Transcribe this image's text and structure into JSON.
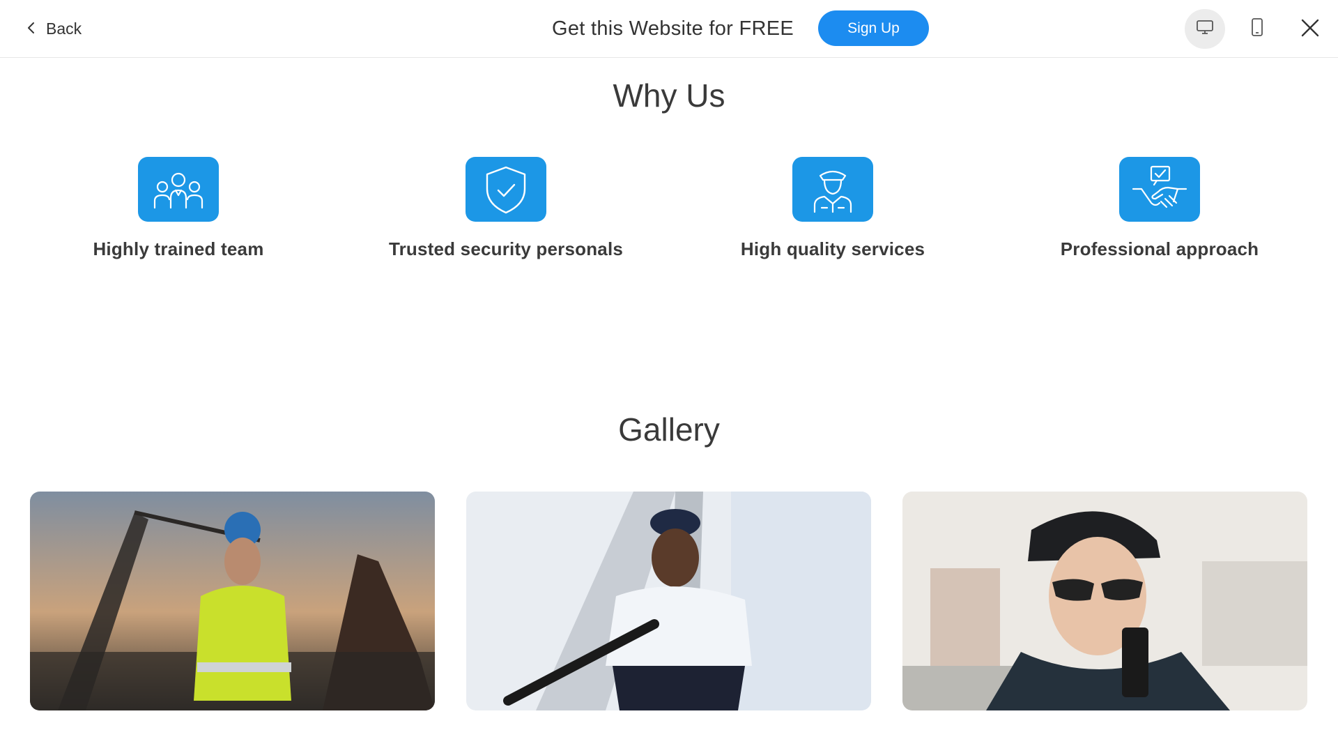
{
  "topbar": {
    "back_label": "Back",
    "promo_text": "Get this Website for FREE",
    "signup_label": "Sign Up"
  },
  "why_us": {
    "title": "Why Us",
    "features": [
      {
        "label": "Highly trained team",
        "icon": "team-icon"
      },
      {
        "label": "Trusted security personals",
        "icon": "shield-check-icon"
      },
      {
        "label": "High quality services",
        "icon": "officer-icon"
      },
      {
        "label": "Professional approach",
        "icon": "handshake-icon"
      }
    ]
  },
  "gallery": {
    "title": "Gallery"
  },
  "colors": {
    "accent": "#1c8cf0",
    "icon_bg": "#1c97e6"
  }
}
